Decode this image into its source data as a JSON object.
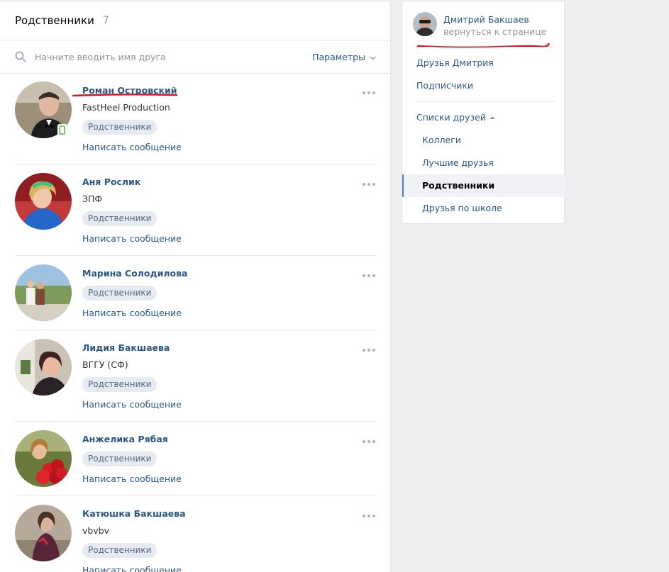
{
  "main": {
    "title": "Родственники",
    "count": "7",
    "search_placeholder": "Начните вводить имя друга",
    "params_label": "Параметры"
  },
  "friends": [
    {
      "name": "Роман Островский",
      "sub": "FastHeel Production",
      "badge": "Родственники",
      "action": "Написать сообщение"
    },
    {
      "name": "Аня Рослик",
      "sub": "ЗПФ",
      "badge": "Родственники",
      "action": "Написать сообщение"
    },
    {
      "name": "Марина Солодилова",
      "sub": "",
      "badge": "Родственники",
      "action": "Написать сообщение"
    },
    {
      "name": "Лидия Бакшаева",
      "sub": "ВГГУ (СФ)",
      "badge": "Родственники",
      "action": "Написать сообщение"
    },
    {
      "name": "Анжелика Рябая",
      "sub": "",
      "badge": "Родственники",
      "action": "Написать сообщение"
    },
    {
      "name": "Катюшка Бакшаева",
      "sub": "vbvbv",
      "badge": "Родственники",
      "action": "Написать сообщение"
    }
  ],
  "sidebar": {
    "owner_name": "Дмитрий Бакшаев",
    "owner_back": "вернуться к странице",
    "items": [
      {
        "label": "Друзья Дмитрия"
      },
      {
        "label": "Подписчики"
      }
    ],
    "lists_header": "Списки друзей",
    "lists": [
      {
        "label": "Коллеги"
      },
      {
        "label": "Лучшие друзья"
      },
      {
        "label": "Родственники"
      },
      {
        "label": "Друзья по школе"
      }
    ]
  },
  "colors": {
    "link": "#2a5885",
    "badge_bg": "#e5ebf1",
    "annotation_red": "#d8141f",
    "online": "#8ac176"
  }
}
